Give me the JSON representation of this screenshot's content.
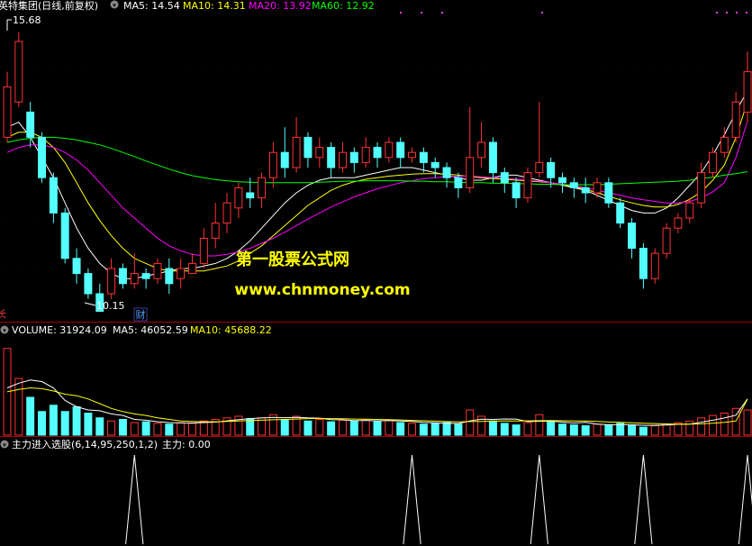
{
  "colors": {
    "background": "#000000",
    "up": "#ff3333",
    "down": "#54ffff",
    "ma5": "#ffffff",
    "ma10": "#ffff00",
    "ma20": "#ff00ff",
    "ma60": "#00ff00",
    "separator": "#a00000",
    "indicator_line": "#ffffff",
    "watermark": "#ffff00"
  },
  "price_panel": {
    "title": "英特集团(日线,前复权)",
    "legend": [
      {
        "key": "ma5",
        "label": "MA5: 14.54"
      },
      {
        "key": "ma10",
        "label": "MA10: 14.31"
      },
      {
        "key": "ma20",
        "label": "MA20: 13.92"
      },
      {
        "key": "ma60",
        "label": "MA60: 12.92"
      }
    ],
    "high_label": "15.68",
    "low_label": "10.15",
    "event_marker": "财",
    "side_marker": "长"
  },
  "volume_panel": {
    "legend": [
      {
        "key": "vol",
        "label": "VOLUME: 31924.09"
      },
      {
        "key": "ma5",
        "label": "MA5: 46052.59"
      },
      {
        "key": "ma10",
        "label": "MA10: 45688.22"
      }
    ]
  },
  "indicator_panel": {
    "title": "主力进入选股(6,14,95,250,1,2)",
    "value_label": "主力: 0.00"
  },
  "watermark": {
    "line1": "第一股票公式网",
    "line2": "www.chnmoney.com"
  },
  "chart_data": [
    {
      "type": "candlestick",
      "title": "英特集团(日线,前复权)",
      "ylim": [
        10.0,
        16.0
      ],
      "annotations": [
        {
          "label": "15.68",
          "x": 1,
          "value": 15.68
        },
        {
          "label": "10.15",
          "x": 18,
          "value": 10.15
        }
      ],
      "series": [
        {
          "name": "MA5",
          "values": [
            13.8,
            13.9,
            13.6,
            13.2,
            12.8,
            12.3,
            11.8,
            11.4,
            11.1,
            10.9,
            10.8,
            10.8,
            10.85,
            10.9,
            10.95,
            11.0,
            11.0,
            11.05,
            11.1,
            11.2,
            11.35,
            11.55,
            11.8,
            12.05,
            12.3,
            12.5,
            12.65,
            12.75,
            12.8,
            12.8,
            12.8,
            12.85,
            12.9,
            12.95,
            13.0,
            13.0,
            12.95,
            12.9,
            12.85,
            12.8,
            12.75,
            12.75,
            12.8,
            12.85,
            12.85,
            12.8,
            12.75,
            12.7,
            12.65,
            12.6,
            12.55,
            12.45,
            12.35,
            12.25,
            12.15,
            12.1,
            12.1,
            12.2,
            12.4,
            12.65,
            12.9,
            13.25,
            13.65,
            14.1,
            14.54
          ]
        },
        {
          "name": "MA10",
          "values": [
            13.6,
            13.7,
            13.7,
            13.6,
            13.4,
            13.1,
            12.7,
            12.3,
            11.95,
            11.65,
            11.4,
            11.2,
            11.1,
            11.0,
            10.95,
            10.95,
            10.95,
            10.95,
            11.0,
            11.05,
            11.15,
            11.3,
            11.45,
            11.65,
            11.85,
            12.05,
            12.25,
            12.4,
            12.55,
            12.65,
            12.72,
            12.77,
            12.8,
            12.83,
            12.85,
            12.87,
            12.88,
            12.88,
            12.87,
            12.85,
            12.82,
            12.8,
            12.78,
            12.77,
            12.75,
            12.74,
            12.72,
            12.7,
            12.66,
            12.62,
            12.57,
            12.5,
            12.43,
            12.36,
            12.3,
            12.25,
            12.22,
            12.22,
            12.27,
            12.37,
            12.52,
            12.75,
            13.05,
            13.6,
            14.31
          ]
        },
        {
          "name": "MA20",
          "values": [
            13.3,
            13.4,
            13.45,
            13.45,
            13.4,
            13.3,
            13.15,
            12.95,
            12.7,
            12.45,
            12.2,
            12.0,
            11.8,
            11.6,
            11.45,
            11.35,
            11.28,
            11.25,
            11.25,
            11.28,
            11.33,
            11.4,
            11.5,
            11.6,
            11.72,
            11.85,
            11.98,
            12.1,
            12.22,
            12.32,
            12.42,
            12.5,
            12.58,
            12.64,
            12.7,
            12.74,
            12.78,
            12.8,
            12.82,
            12.83,
            12.83,
            12.82,
            12.8,
            12.79,
            12.77,
            12.75,
            12.73,
            12.7,
            12.67,
            12.64,
            12.6,
            12.55,
            12.5,
            12.45,
            12.4,
            12.36,
            12.33,
            12.3,
            12.3,
            12.33,
            12.4,
            12.52,
            12.7,
            13.2,
            13.92
          ]
        },
        {
          "name": "MA60",
          "values": [
            13.5,
            13.55,
            13.58,
            13.6,
            13.6,
            13.58,
            13.55,
            13.5,
            13.45,
            13.38,
            13.3,
            13.22,
            13.13,
            13.05,
            12.97,
            12.9,
            12.84,
            12.8,
            12.76,
            12.74,
            12.72,
            12.71,
            12.7,
            12.7,
            12.7,
            12.7,
            12.7,
            12.71,
            12.72,
            12.73,
            12.73,
            12.74,
            12.74,
            12.74,
            12.74,
            12.73,
            12.73,
            12.72,
            12.72,
            12.71,
            12.7,
            12.7,
            12.69,
            12.69,
            12.68,
            12.68,
            12.67,
            12.67,
            12.66,
            12.66,
            12.66,
            12.66,
            12.67,
            12.68,
            12.69,
            12.7,
            12.71,
            12.72,
            12.73,
            12.75,
            12.78,
            12.81,
            12.85,
            12.88,
            12.92
          ]
        }
      ],
      "candles": [
        [
          13.6,
          14.6,
          13.5,
          14.9
        ],
        [
          14.3,
          15.5,
          14.2,
          15.68
        ],
        [
          14.1,
          13.6,
          13.4,
          14.3
        ],
        [
          13.6,
          12.8,
          12.7,
          13.7
        ],
        [
          12.8,
          12.1,
          11.9,
          12.9
        ],
        [
          12.1,
          11.2,
          11.1,
          12.2
        ],
        [
          11.2,
          10.9,
          10.7,
          11.4
        ],
        [
          10.9,
          10.5,
          10.4,
          11.0
        ],
        [
          10.5,
          10.15,
          10.15,
          10.7
        ],
        [
          10.5,
          11.0,
          10.4,
          11.2
        ],
        [
          11.0,
          10.7,
          10.6,
          11.1
        ],
        [
          10.7,
          10.9,
          10.6,
          11.3
        ],
        [
          10.9,
          10.8,
          10.6,
          11.0
        ],
        [
          10.8,
          11.1,
          10.7,
          11.2
        ],
        [
          11.0,
          10.7,
          10.5,
          11.2
        ],
        [
          10.8,
          11.0,
          10.6,
          11.2
        ],
        [
          10.9,
          11.1,
          10.9,
          11.3
        ],
        [
          11.1,
          11.6,
          11.0,
          11.8
        ],
        [
          11.6,
          11.9,
          11.4,
          12.3
        ],
        [
          11.9,
          12.3,
          11.7,
          12.5
        ],
        [
          12.2,
          12.6,
          12.0,
          12.7
        ],
        [
          12.5,
          12.4,
          12.2,
          12.8
        ],
        [
          12.4,
          12.8,
          12.2,
          12.9
        ],
        [
          12.8,
          13.3,
          12.6,
          13.5
        ],
        [
          13.3,
          13.0,
          12.8,
          13.8
        ],
        [
          13.0,
          13.6,
          12.9,
          14.0
        ],
        [
          13.6,
          13.2,
          13.0,
          13.7
        ],
        [
          13.2,
          13.4,
          13.0,
          13.6
        ],
        [
          13.4,
          13.0,
          12.8,
          13.5
        ],
        [
          13.0,
          13.3,
          12.9,
          13.5
        ],
        [
          13.3,
          13.1,
          12.9,
          13.4
        ],
        [
          13.1,
          13.4,
          13.0,
          13.6
        ],
        [
          13.4,
          13.2,
          13.0,
          13.5
        ],
        [
          13.2,
          13.5,
          13.1,
          13.6
        ],
        [
          13.5,
          13.2,
          13.0,
          13.6
        ],
        [
          13.2,
          13.3,
          13.1,
          13.4
        ],
        [
          13.3,
          13.1,
          12.9,
          13.4
        ],
        [
          13.1,
          13.0,
          12.8,
          13.2
        ],
        [
          13.0,
          12.8,
          12.6,
          13.1
        ],
        [
          12.8,
          12.6,
          12.4,
          12.9
        ],
        [
          12.6,
          13.2,
          12.5,
          14.2
        ],
        [
          13.2,
          13.5,
          13.0,
          13.9
        ],
        [
          13.5,
          12.9,
          12.7,
          13.6
        ],
        [
          12.9,
          12.7,
          12.5,
          13.0
        ],
        [
          12.7,
          12.4,
          12.2,
          12.8
        ],
        [
          12.4,
          12.9,
          12.3,
          13.0
        ],
        [
          12.9,
          13.1,
          12.8,
          14.3
        ],
        [
          13.1,
          12.8,
          12.6,
          13.2
        ],
        [
          12.8,
          12.7,
          12.5,
          12.9
        ],
        [
          12.7,
          12.6,
          12.4,
          12.8
        ],
        [
          12.6,
          12.5,
          12.3,
          12.8
        ],
        [
          12.5,
          12.7,
          12.4,
          12.8
        ],
        [
          12.7,
          12.3,
          12.2,
          12.8
        ],
        [
          12.3,
          11.9,
          11.8,
          12.4
        ],
        [
          11.9,
          11.4,
          11.2,
          12.0
        ],
        [
          11.4,
          10.8,
          10.6,
          11.5
        ],
        [
          10.8,
          11.3,
          10.7,
          11.4
        ],
        [
          11.3,
          11.8,
          11.2,
          11.9
        ],
        [
          11.8,
          12.0,
          11.7,
          12.1
        ],
        [
          12.0,
          12.3,
          11.9,
          12.4
        ],
        [
          12.3,
          12.9,
          12.2,
          13.1
        ],
        [
          12.9,
          13.3,
          12.8,
          13.4
        ],
        [
          13.3,
          13.6,
          13.2,
          13.8
        ],
        [
          13.6,
          14.3,
          13.5,
          14.5
        ],
        [
          14.1,
          14.9,
          13.9,
          15.3
        ]
      ]
    },
    {
      "type": "bar",
      "title": "VOLUME",
      "ylim": [
        0,
        120000
      ],
      "series": [
        {
          "name": "VOLUME",
          "values": [
            110000,
            72000,
            48000,
            30000,
            38000,
            30000,
            36000,
            28000,
            22000,
            18000,
            20000,
            16000,
            17000,
            15000,
            14000,
            16000,
            15000,
            18000,
            20000,
            22000,
            24000,
            21000,
            22000,
            26000,
            20000,
            24000,
            18000,
            20000,
            17000,
            19000,
            18000,
            20000,
            17000,
            19000,
            16000,
            15000,
            14000,
            15000,
            16000,
            14000,
            32000,
            24000,
            18000,
            15000,
            13000,
            16000,
            26000,
            17000,
            14000,
            13000,
            12000,
            14000,
            13000,
            15000,
            12000,
            10000,
            12000,
            14000,
            16000,
            18000,
            22000,
            25000,
            28000,
            34000,
            31924
          ]
        },
        {
          "name": "MA5",
          "values": [
            60000,
            66000,
            70000,
            68000,
            60000,
            44000,
            36000,
            32000,
            31000,
            27000,
            25000,
            20000,
            19000,
            17000,
            16000,
            15600,
            15400,
            16000,
            16600,
            18200,
            19800,
            21000,
            21800,
            22600,
            22200,
            22600,
            22000,
            21600,
            19800,
            19600,
            18400,
            18800,
            18200,
            18600,
            18000,
            17400,
            16200,
            15800,
            15200,
            14800,
            18200,
            20200,
            20000,
            20600,
            20400,
            17200,
            17600,
            17800,
            16600,
            15400,
            16200,
            14000,
            13200,
            13400,
            13200,
            12400,
            12400,
            12800,
            13800,
            14000,
            16400,
            19000,
            21800,
            25400,
            46052
          ]
        },
        {
          "name": "MA10",
          "values": [
            55000,
            58000,
            60000,
            59000,
            56000,
            52000,
            50000,
            46000,
            40000,
            34000,
            30000,
            27000,
            25000,
            22000,
            20000,
            18000,
            17500,
            17000,
            17000,
            17500,
            18000,
            18500,
            19000,
            19500,
            20000,
            20500,
            21000,
            21200,
            21000,
            20800,
            20500,
            20200,
            20000,
            19700,
            19300,
            18800,
            18300,
            17800,
            17300,
            16900,
            17200,
            17500,
            17800,
            18000,
            18100,
            18200,
            18400,
            18500,
            18300,
            18100,
            17900,
            17400,
            16700,
            16200,
            15700,
            15200,
            14700,
            14300,
            14100,
            14000,
            14400,
            15200,
            16300,
            18000,
            45688
          ]
        }
      ]
    },
    {
      "type": "line",
      "title": "主力进入选股(6,14,95,250,1,2)",
      "ylim": [
        0,
        1
      ],
      "series": [
        {
          "name": "主力",
          "values": [
            0,
            0,
            0,
            0,
            0,
            0,
            0,
            0,
            0,
            0,
            0,
            1,
            0,
            0,
            0,
            0,
            0,
            0,
            0,
            0,
            0,
            0,
            0,
            0,
            0,
            0,
            0,
            0,
            0,
            0,
            0,
            0,
            0,
            0,
            0,
            1,
            0,
            0,
            0,
            0,
            0,
            0,
            0,
            0,
            0,
            0,
            1,
            0,
            0,
            0,
            0,
            0,
            0,
            0,
            0,
            1,
            0,
            0,
            0,
            0,
            0,
            0,
            0,
            0,
            0
          ]
        }
      ],
      "events": [
        {
          "index": 11,
          "value": 1
        },
        {
          "index": 35,
          "value": 1
        },
        {
          "index": 46,
          "value": 1
        },
        {
          "index": 55,
          "value": 1
        },
        {
          "index": 64,
          "value": 1
        }
      ]
    }
  ]
}
